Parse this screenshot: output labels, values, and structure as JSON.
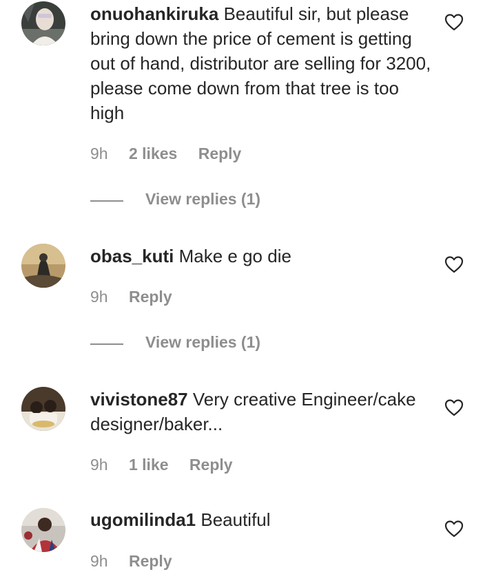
{
  "comments": [
    {
      "username": "onuohankiruka",
      "text": "Beautiful sir, but please bring down the price of cement is getting out of hand, distributor are selling for 3200, please come down from that tree is too high",
      "time": "9h",
      "likes": "2 likes",
      "reply": "Reply",
      "view_replies": "View replies (1)"
    },
    {
      "username": "obas_kuti",
      "text": "Make e go die",
      "time": "9h",
      "reply": "Reply",
      "view_replies": "View replies (1)"
    },
    {
      "username": "vivistone87",
      "text": "Very creative Engineer/cake designer/baker...",
      "time": "9h",
      "likes": "1 like",
      "reply": "Reply"
    },
    {
      "username": "ugomilinda1",
      "text": "Beautiful",
      "time": "9h",
      "reply": "Reply"
    }
  ],
  "icons": {
    "like": "heart-outline-icon"
  },
  "colors": {
    "primary_text": "#262626",
    "secondary_text": "#8e8e8e",
    "background": "#ffffff"
  }
}
